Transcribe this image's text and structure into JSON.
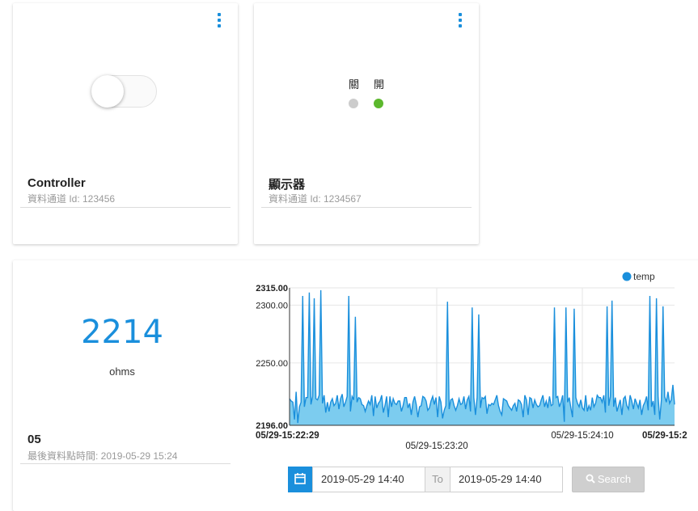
{
  "widgets": {
    "controller": {
      "title": "Controller",
      "channel": "資料通道 Id: 123456"
    },
    "display": {
      "title": "顯示器",
      "channel": "資料通道 Id: 1234567",
      "off_label": "關",
      "on_label": "開",
      "off_color": "#cccccc",
      "on_color": "#5cb82d"
    },
    "sensor": {
      "value": "2214",
      "unit": "ohms",
      "title": "05",
      "last_update": "最後資料點時間: 2019-05-29 15:24"
    }
  },
  "date_range": {
    "from": "2019-05-29 14:40",
    "to_label": "To",
    "to": "2019-05-29 14:40",
    "search_label": "Search"
  },
  "chart_data": {
    "type": "area",
    "legend": [
      "temp"
    ],
    "legend_position": "top-right",
    "ylim": [
      2196,
      2315
    ],
    "yticks": [
      "2196.00",
      "2250.00",
      "2300.00",
      "2315.00"
    ],
    "xticks": [
      "05/29-15:22:29",
      "05/29-15:23:20",
      "05/29-15:24:10",
      "05/29-15:2"
    ],
    "grid": true,
    "color": "#1a8fdc",
    "fill": "#7cccef",
    "series": [
      {
        "name": "temp",
        "values": [
          2219,
          2217,
          2216,
          2201,
          2225,
          2198,
          2212,
          2216,
          2308,
          2212,
          2220,
          2220,
          2311,
          2214,
          2221,
          2306,
          2219,
          2218,
          2222,
          2313,
          2215,
          2222,
          2207,
          2216,
          2208,
          2216,
          2219,
          2213,
          2215,
          2222,
          2210,
          2219,
          2223,
          2212,
          2216,
          2221,
          2308,
          2208,
          2221,
          2218,
          2290,
          2216,
          2220,
          2219,
          2214,
          2213,
          2208,
          2213,
          2217,
          2214,
          2222,
          2204,
          2221,
          2211,
          2215,
          2217,
          2222,
          2207,
          2213,
          2221,
          2203,
          2221,
          2212,
          2219,
          2215,
          2214,
          2217,
          2217,
          2208,
          2213,
          2220,
          2220,
          2211,
          2215,
          2205,
          2216,
          2221,
          2214,
          2203,
          2212,
          2213,
          2221,
          2220,
          2217,
          2209,
          2211,
          2217,
          2221,
          2214,
          2220,
          2203,
          2221,
          2216,
          2202,
          2209,
          2213,
          2303,
          2210,
          2218,
          2219,
          2213,
          2209,
          2213,
          2219,
          2214,
          2215,
          2221,
          2210,
          2218,
          2221,
          2208,
          2298,
          2220,
          2205,
          2220,
          2292,
          2211,
          2220,
          2219,
          2221,
          2206,
          2214,
          2213,
          2215,
          2214,
          2218,
          2222,
          2213,
          2208,
          2205,
          2219,
          2218,
          2217,
          2213,
          2211,
          2209,
          2213,
          2215,
          2208,
          2218,
          2217,
          2214,
          2203,
          2222,
          2218,
          2205,
          2220,
          2219,
          2211,
          2218,
          2214,
          2212,
          2213,
          2218,
          2222,
          2212,
          2217,
          2211,
          2221,
          2213,
          2214,
          2298,
          2220,
          2221,
          2212,
          2216,
          2222,
          2199,
          2298,
          2216,
          2220,
          2211,
          2203,
          2297,
          2220,
          2215,
          2212,
          2218,
          2211,
          2209,
          2222,
          2208,
          2213,
          2209,
          2220,
          2212,
          2215,
          2222,
          2220,
          2220,
          2216,
          2222,
          2207,
          2299,
          2213,
          2221,
          2304,
          2212,
          2220,
          2208,
          2213,
          2218,
          2205,
          2219,
          2221,
          2213,
          2210,
          2222,
          2217,
          2210,
          2219,
          2215,
          2211,
          2218,
          2205,
          2213,
          2216,
          2221,
          2209,
          2308,
          2212,
          2217,
          2205,
          2306,
          2221,
          2201,
          2218,
          2299,
          2221,
          2216,
          2225,
          2215,
          2218,
          2231,
          2214
        ]
      }
    ]
  }
}
